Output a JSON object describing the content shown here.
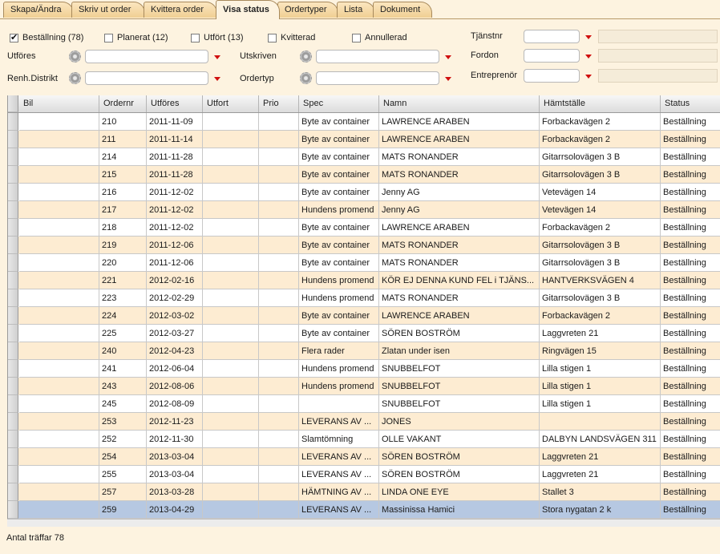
{
  "tabs": [
    {
      "label": "Skapa/Ändra"
    },
    {
      "label": "Skriv ut order"
    },
    {
      "label": "Kvittera order"
    },
    {
      "label": "Visa status"
    },
    {
      "label": "Ordertyper"
    },
    {
      "label": "Lista"
    },
    {
      "label": "Dokument"
    }
  ],
  "filters": {
    "checkboxes": [
      {
        "label": "Beställning (78)",
        "checked": true
      },
      {
        "label": "Planerat (12)",
        "checked": false
      },
      {
        "label": "Utfört (13)",
        "checked": false
      },
      {
        "label": "Kvitterad",
        "checked": false
      },
      {
        "label": "Annullerad",
        "checked": false
      }
    ],
    "utfores_label": "Utföres",
    "utfores_value": "",
    "renh_label": "Renh.Distrikt",
    "renh_value": "",
    "utskriven_label": "Utskriven",
    "utskriven_value": "",
    "ordertyp_label": "Ordertyp",
    "ordertyp_value": "",
    "tjanstnr_label": "Tjänstnr",
    "tjanstnr_value": "",
    "fordon_label": "Fordon",
    "fordon_value": "",
    "entreprenor_label": "Entreprenör",
    "entreprenor_value": ""
  },
  "grid": {
    "columns": [
      "Bil",
      "Ordernr",
      "Utföres",
      "Utfort",
      "Prio",
      "Spec",
      "Namn",
      "Hämtställe",
      "Status"
    ],
    "rows": [
      [
        "",
        "210",
        "2011-11-09",
        "",
        "",
        "Byte av container",
        "LAWRENCE ARABEN",
        "Forbackavägen 2",
        "Beställning"
      ],
      [
        "",
        "211",
        "2011-11-14",
        "",
        "",
        "Byte av container",
        "LAWRENCE ARABEN",
        "Forbackavägen 2",
        "Beställning"
      ],
      [
        "",
        "214",
        "2011-11-28",
        "",
        "",
        "Byte av container",
        "MATS RONANDER",
        "Gitarrsolovägen 3 B",
        "Beställning"
      ],
      [
        "",
        "215",
        "2011-11-28",
        "",
        "",
        "Byte av container",
        "MATS RONANDER",
        "Gitarrsolovägen 3 B",
        "Beställning"
      ],
      [
        "",
        "216",
        "2011-12-02",
        "",
        "",
        "Byte av container",
        "Jenny AG",
        "Vetevägen 14",
        "Beställning"
      ],
      [
        "",
        "217",
        "2011-12-02",
        "",
        "",
        "Hundens promend",
        "Jenny AG",
        "Vetevägen 14",
        "Beställning"
      ],
      [
        "",
        "218",
        "2011-12-02",
        "",
        "",
        "Byte av container",
        "LAWRENCE ARABEN",
        "Forbackavägen 2",
        "Beställning"
      ],
      [
        "",
        "219",
        "2011-12-06",
        "",
        "",
        "Byte av container",
        "MATS RONANDER",
        "Gitarrsolovägen 3 B",
        "Beställning"
      ],
      [
        "",
        "220",
        "2011-12-06",
        "",
        "",
        "Byte av container",
        "MATS RONANDER",
        "Gitarrsolovägen 3 B",
        "Beställning"
      ],
      [
        "",
        "221",
        "2012-02-16",
        "",
        "",
        "Hundens promend",
        "KÖR EJ DENNA KUND FEL i TJÄNS...",
        "HANTVERKSVÄGEN 4",
        "Beställning"
      ],
      [
        "",
        "223",
        "2012-02-29",
        "",
        "",
        "Hundens promend",
        "MATS RONANDER",
        "Gitarrsolovägen 3 B",
        "Beställning"
      ],
      [
        "",
        "224",
        "2012-03-02",
        "",
        "",
        "Byte av container",
        "LAWRENCE ARABEN",
        "Forbackavägen 2",
        "Beställning"
      ],
      [
        "",
        "225",
        "2012-03-27",
        "",
        "",
        "Byte av container",
        "SÖREN BOSTRÖM",
        "Laggvreten 21",
        "Beställning"
      ],
      [
        "",
        "240",
        "2012-04-23",
        "",
        "",
        "Flera rader",
        "Zlatan under isen",
        "Ringvägen 15",
        "Beställning"
      ],
      [
        "",
        "241",
        "2012-06-04",
        "",
        "",
        "Hundens promend",
        "SNUBBELFOT",
        "Lilla stigen 1",
        "Beställning"
      ],
      [
        "",
        "243",
        "2012-08-06",
        "",
        "",
        "Hundens promend",
        "SNUBBELFOT",
        "Lilla stigen 1",
        "Beställning"
      ],
      [
        "",
        "245",
        "2012-08-09",
        "",
        "",
        "",
        "SNUBBELFOT",
        "Lilla stigen 1",
        "Beställning"
      ],
      [
        "",
        "253",
        "2012-11-23",
        "",
        "",
        "LEVERANS AV ...",
        "JONES",
        "",
        "Beställning"
      ],
      [
        "",
        "252",
        "2012-11-30",
        "",
        "",
        "Slamtömning",
        "OLLE VAKANT",
        "DALBYN LANDSVÄGEN 311",
        "Beställning"
      ],
      [
        "",
        "254",
        "2013-03-04",
        "",
        "",
        "LEVERANS AV ...",
        "SÖREN BOSTRÖM",
        "Laggvreten 21",
        "Beställning"
      ],
      [
        "",
        "255",
        "2013-03-04",
        "",
        "",
        "LEVERANS AV ...",
        "SÖREN BOSTRÖM",
        "Laggvreten 21",
        "Beställning"
      ],
      [
        "",
        "257",
        "2013-03-28",
        "",
        "",
        "HÄMTNING AV ...",
        "LINDA ONE EYE",
        "Stallet 3",
        "Beställning"
      ],
      [
        "",
        "259",
        "2013-04-29",
        "",
        "",
        "LEVERANS AV ...",
        "Massinissa Hamici",
        "Stora nygatan 2 k",
        "Beställning"
      ]
    ],
    "selected_row": 22
  },
  "status_bar": {
    "text": "Antal träffar 78"
  },
  "colors": {
    "background": "#fdf3e0",
    "row_alt": "#fdecd2",
    "row_selected": "#b6c8e2",
    "dropdown_arrow": "#d01010"
  }
}
